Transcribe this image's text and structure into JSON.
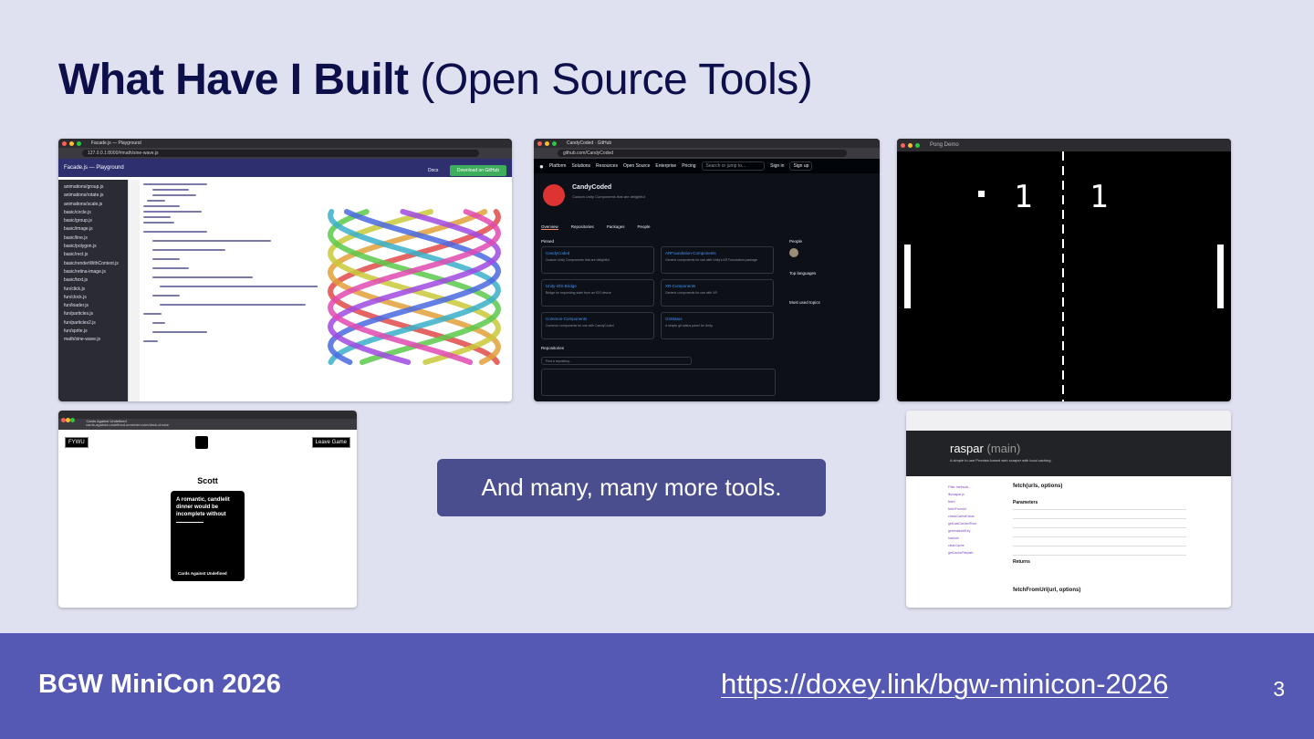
{
  "slide": {
    "title_bold": "What Have I Built",
    "title_rest": "(Open Source Tools)",
    "callout": "And many, many more tools.",
    "footer_left": "BGW MiniCon 2026",
    "footer_link": "https://doxey.link/bgw-minicon-2026",
    "page_number": "3"
  },
  "facade": {
    "tab_title": "Facade.js — Playground",
    "url": "127.0.0.1:8000/#math/sine-wave.js",
    "nav_title": "Facade.js — Playground",
    "docs_label": "Docs",
    "download_label": "Download on GitHub",
    "files": [
      "animations/group.js",
      "animations/rotate.js",
      "animations/scale.js",
      "basic/circle.js",
      "basic/group.js",
      "basic/image.js",
      "basic/line.js",
      "basic/polygon.js",
      "basic/rect.js",
      "basic/renderWithContext.js",
      "basic/retina-image.js",
      "basic/text.js",
      "fun/click.js",
      "fun/clock.js",
      "fun/loader.js",
      "fun/particles.js",
      "fun/particles2.js",
      "fun/sprite.js",
      "math/sine-wave.js"
    ]
  },
  "github": {
    "tab_title": "CandyCoded · GitHub",
    "url": "github.com/CandyCoded",
    "nav": [
      "Platform",
      "Solutions",
      "Resources",
      "Open Source",
      "Enterprise",
      "Pricing"
    ],
    "search": "Search or jump to...",
    "signin": "Sign in",
    "signup": "Sign up",
    "org_name": "CandyCoded",
    "org_desc": "Custom Unity Components that are delightful",
    "tabs": [
      "Overview",
      "Repositories",
      "Packages",
      "People"
    ],
    "pinned_label": "Pinned",
    "pinned": [
      {
        "name": "CandyCoded",
        "desc": "Custom Unity Components that are delightful"
      },
      {
        "name": "ARFoundation-Components",
        "desc": "Generic components for use with Unity's AR Foundation package"
      },
      {
        "name": "Unity-iOS-Bridge",
        "desc": "Bridge for requesting state from an iOS device"
      },
      {
        "name": "XR-Components",
        "desc": "Generic components for use with XR"
      },
      {
        "name": "Common-Components",
        "desc": "Common components for use with CandyCoded"
      },
      {
        "name": "GitStatus",
        "desc": "A simple git status panel for Unity."
      }
    ],
    "people_label": "People",
    "top_languages_label": "Top languages",
    "most_used_topics_label": "Most used topics",
    "repositories_label": "Repositories",
    "find_repo": "Find a repository..."
  },
  "pong": {
    "window_title": "Pong Demo",
    "score_left": "1",
    "score_right": "1"
  },
  "cards": {
    "tab_title": "Cards Against Undefined",
    "url": "cards-against-undefined.onrender.com/deck-choice",
    "room_code": "FYWU",
    "leave_label": "Leave Game",
    "player": "Scott",
    "card_text": "A romantic, candlelit dinner would be incomplete without",
    "card_footer": "Cards Against Undefined"
  },
  "raspar": {
    "name": "raspar",
    "branch": "(main)",
    "desc": "A simple to use Promise-based web scraper with local caching.",
    "sidebar": [
      "Filter methods...",
      "lib/raspar.js",
      "fetch",
      "fetchFromUrl",
      "checkCacheExists",
      "getLastCachedTime",
      "generateUrlKey",
      "hashUrl",
      "clearCache",
      "getCacheFilepath"
    ],
    "section1": "fetch(urls, options)",
    "params_label": "Parameters",
    "returns_label": "Returns",
    "section2": "fetchFromUrl(url, options)"
  }
}
